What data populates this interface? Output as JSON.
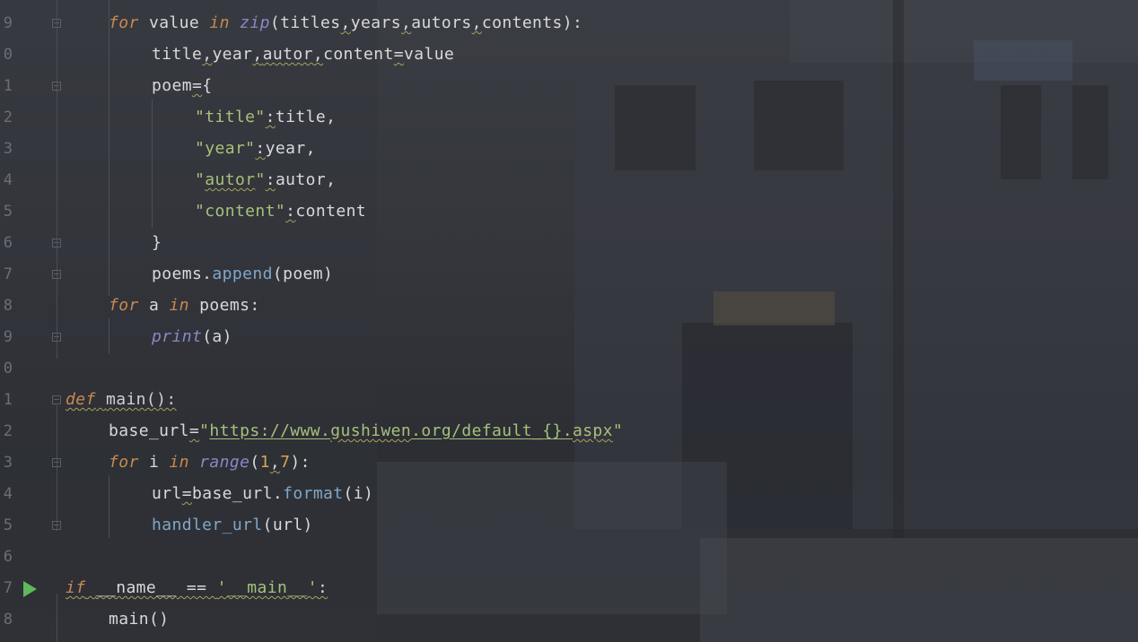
{
  "editor": {
    "language": "python",
    "line_numbers": [
      "9",
      "0",
      "1",
      "2",
      "3",
      "4",
      "5",
      "6",
      "7",
      "8",
      "9",
      "0",
      "1",
      "2",
      "3",
      "4",
      "5",
      "6",
      "7",
      "8"
    ],
    "code": {
      "for_value": {
        "kw_for": "for",
        "var": " value ",
        "kw_in": "in",
        "fn": "zip",
        "args": "(titles",
        "c1": ",",
        "a2": "years",
        "c2": ",",
        "a3": "autors",
        "c3": ",",
        "a4": "contents):"
      },
      "unpack": {
        "v1": "title",
        "c1": ",",
        "v2": "year",
        "c2": ",",
        "v3": "autor",
        "c3": ",",
        "v4": "content",
        "eq": "=",
        "rhs": "value"
      },
      "poem_open": {
        "name": "poem",
        "eq": "=",
        "brace": "{"
      },
      "poem_title": {
        "key": "\"title\"",
        "colon": ":",
        "val": "title,"
      },
      "poem_year": {
        "key": "\"year\"",
        "colon": ":",
        "val": "year,"
      },
      "poem_autor": {
        "q1": "\"",
        "key": "autor",
        "q2": "\"",
        "colon": ":",
        "val": "autor,"
      },
      "poem_content": {
        "key": "\"content\"",
        "colon": ":",
        "val": "content"
      },
      "poem_close": "}",
      "append": {
        "obj": "poems.",
        "method": "append",
        "args": "(poem)"
      },
      "for_a": {
        "kw_for": "for",
        "mid": " a ",
        "kw_in": "in",
        "rest": " poems:"
      },
      "print": {
        "fn": "print",
        "args": "(a)"
      },
      "def_main": {
        "kw_def": "def",
        "sp": " ",
        "name": "main():"
      },
      "base_url": {
        "name": "base_url",
        "eq": "=",
        "q1": "\"",
        "url_a": "https://www.",
        "url_b": "gushiwen",
        "url_c": ".org/default_{}.",
        "url_d": "aspx",
        "q2": "\""
      },
      "for_i": {
        "kw_for": "for",
        "mid": " i ",
        "kw_in": "in",
        "sp": " ",
        "fn": "range",
        "p1": "(",
        "n1": "1",
        "comma": ",",
        "n2": "7",
        "p2": "):"
      },
      "url_assign": {
        "name": "url",
        "eq": "=",
        "obj": "base_url.",
        "method": "format",
        "args": "(i)"
      },
      "handler": {
        "fn": "handler_url",
        "args": "(url)"
      },
      "if_main": {
        "kw_if": "if",
        "sp": " ",
        "name": "__name__",
        "op": " == ",
        "str": "'__main__'",
        "colon": ":"
      },
      "main_call": "main()"
    }
  },
  "colors": {
    "keyword": "#c8894f",
    "string": "#a8c07a",
    "number": "#d8a35a",
    "method": "#7fa7c9",
    "builtin": "#8888c6",
    "run_icon": "#5fb85a"
  }
}
